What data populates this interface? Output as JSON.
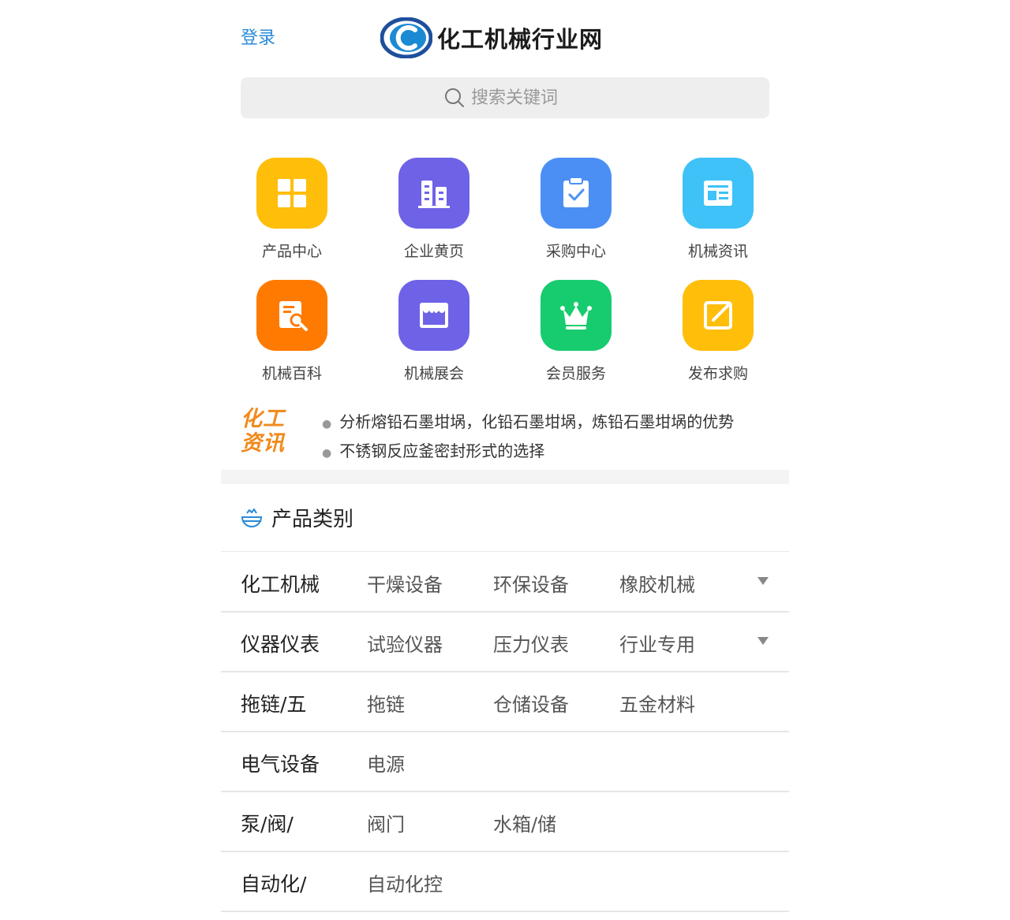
{
  "header": {
    "login_label": "登录",
    "site_name": "化工机械行业网",
    "logo_letter": "C"
  },
  "search": {
    "placeholder": "搜索关键词"
  },
  "nav_grid": [
    {
      "label": "产品中心",
      "icon": "grid-icon",
      "color": "#ffbe0a"
    },
    {
      "label": "企业黄页",
      "icon": "building-icon",
      "color": "#6e63e6"
    },
    {
      "label": "采购中心",
      "icon": "clipboard-check-icon",
      "color": "#4b8ff5"
    },
    {
      "label": "机械资讯",
      "icon": "news-icon",
      "color": "#3ec2f7"
    },
    {
      "label": "机械百科",
      "icon": "document-search-icon",
      "color": "#ff7a00"
    },
    {
      "label": "机械展会",
      "icon": "storefront-icon",
      "color": "#6e63e6"
    },
    {
      "label": "会员服务",
      "icon": "crown-icon",
      "color": "#17cc6e"
    },
    {
      "label": "发布求购",
      "icon": "edit-icon",
      "color": "#ffbe0a"
    }
  ],
  "news": {
    "badge_line1": "化工",
    "badge_line2": "资讯",
    "items": [
      "分析熔铅石墨坩埚，化铅石墨坩埚，炼铅石墨坩埚的优势",
      "不锈钢反应釜密封形式的选择"
    ]
  },
  "categories": {
    "title": "产品类别",
    "rows": [
      {
        "main": "化工机械",
        "subs": [
          "干燥设备",
          "环保设备",
          "橡胶机械"
        ],
        "has_more": true
      },
      {
        "main": "仪器仪表",
        "subs": [
          "试验仪器",
          "压力仪表",
          "行业专用"
        ],
        "has_more": true
      },
      {
        "main": "拖链/五",
        "subs": [
          "拖链",
          "仓储设备",
          "五金材料"
        ],
        "has_more": false
      },
      {
        "main": "电气设备",
        "subs": [
          "电源"
        ],
        "has_more": false
      },
      {
        "main": "泵/阀/",
        "subs": [
          "阀门",
          "水箱/储"
        ],
        "has_more": false
      },
      {
        "main": "自动化/",
        "subs": [
          "自动化控"
        ],
        "has_more": false
      }
    ]
  },
  "colors": {
    "accent": "#2b8ad8",
    "news_badge": "#f08a1c"
  }
}
